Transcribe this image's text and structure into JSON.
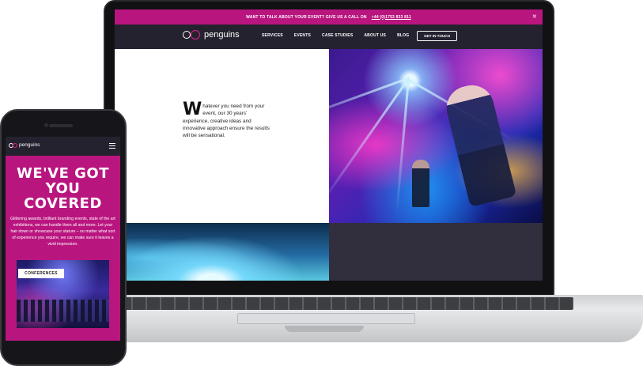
{
  "desktop_site": {
    "promo_bar": {
      "text": "WANT TO TALK ABOUT YOUR EVENT? GIVE US A CALL ON",
      "phone": "+44 (0)1753 833 811",
      "close_icon": "close-icon"
    },
    "nav": {
      "logo_text": "penguins",
      "links": [
        "SERVICES",
        "EVENTS",
        "CASE STUDIES",
        "ABOUT US",
        "BLOG"
      ],
      "cta_label": "GET IN TOUCH"
    },
    "intro": {
      "drop_cap": "W",
      "text": "hatever you need from your event, our 30 years' experience, creative ideas and innovative approach ensure the results will be sensational."
    }
  },
  "mobile_site": {
    "logo_text": "penguins",
    "menu_icon": "hamburger-menu-icon",
    "hero_line1": "WE'VE GOT",
    "hero_line2": "YOU COVERED",
    "body": "Glittering awards, brilliant branding events, state of the art exhibitions, we can handle them all and more. Let your hair down or showcase your stature – no matter what sort of experience you require, we can make sure it leaves a vivid impression.",
    "card_label": "CONFERENCES"
  },
  "colors": {
    "brand_magenta": "#b9157f",
    "nav_dark": "#24222e",
    "logo_pink": "#e0208f"
  }
}
